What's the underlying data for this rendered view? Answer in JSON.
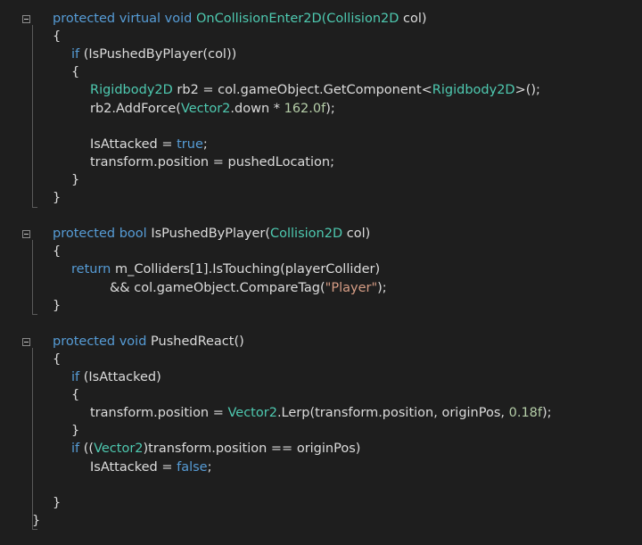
{
  "editor": {
    "background": "#1e1e1e",
    "colors": {
      "keyword": "#569cd6",
      "type": "#4ec9b0",
      "string": "#d69d85",
      "number": "#b5cea8",
      "text": "#dcdcdc"
    },
    "fold_icons": [
      "collapse-icon",
      "collapse-icon",
      "collapse-icon"
    ],
    "lines": [
      {
        "tokens": [
          {
            "t": "protected virtual void ",
            "c": "kw"
          },
          {
            "t": "OnCollisionEnter2D(",
            "c": "type"
          },
          {
            "t": "Collision2D",
            "c": "type"
          },
          {
            "t": " col)",
            "c": "plain"
          }
        ]
      },
      {
        "tokens": [
          {
            "t": "{",
            "c": "plain"
          }
        ]
      },
      {
        "tokens": [
          {
            "t": "if",
            "c": "kw"
          },
          {
            "t": " (IsPushedByPlayer(col))",
            "c": "plain"
          }
        ]
      },
      {
        "tokens": [
          {
            "t": "{",
            "c": "plain"
          }
        ]
      },
      {
        "tokens": [
          {
            "t": "Rigidbody2D",
            "c": "type"
          },
          {
            "t": " rb2 = col.gameObject.GetComponent<",
            "c": "plain"
          },
          {
            "t": "Rigidbody2D",
            "c": "type"
          },
          {
            "t": ">();",
            "c": "plain"
          }
        ]
      },
      {
        "tokens": [
          {
            "t": "rb2.AddForce(",
            "c": "plain"
          },
          {
            "t": "Vector2",
            "c": "type"
          },
          {
            "t": ".down * ",
            "c": "plain"
          },
          {
            "t": "162.0f",
            "c": "num"
          },
          {
            "t": ");",
            "c": "plain"
          }
        ]
      },
      {
        "tokens": []
      },
      {
        "tokens": [
          {
            "t": "IsAttacked = ",
            "c": "plain"
          },
          {
            "t": "true",
            "c": "kw"
          },
          {
            "t": ";",
            "c": "plain"
          }
        ]
      },
      {
        "tokens": [
          {
            "t": "transform.position = pushedLocation;",
            "c": "plain"
          }
        ]
      },
      {
        "tokens": [
          {
            "t": "}",
            "c": "plain"
          }
        ]
      },
      {
        "tokens": [
          {
            "t": "}",
            "c": "plain"
          }
        ]
      },
      {
        "tokens": []
      },
      {
        "tokens": [
          {
            "t": "protected bool ",
            "c": "kw"
          },
          {
            "t": "IsPushedByPlayer(",
            "c": "plain"
          },
          {
            "t": "Collision2D",
            "c": "type"
          },
          {
            "t": " col)",
            "c": "plain"
          }
        ]
      },
      {
        "tokens": [
          {
            "t": "{",
            "c": "plain"
          }
        ]
      },
      {
        "tokens": [
          {
            "t": "return",
            "c": "kw"
          },
          {
            "t": " m_Colliders[1].IsTouching(playerCollider)",
            "c": "plain"
          }
        ]
      },
      {
        "tokens": [
          {
            "t": "&& col.gameObject.CompareTag(",
            "c": "plain"
          },
          {
            "t": "\"Player\"",
            "c": "str"
          },
          {
            "t": ");",
            "c": "plain"
          }
        ]
      },
      {
        "tokens": [
          {
            "t": "}",
            "c": "plain"
          }
        ]
      },
      {
        "tokens": []
      },
      {
        "tokens": [
          {
            "t": "protected void ",
            "c": "kw"
          },
          {
            "t": "PushedReact()",
            "c": "plain"
          }
        ]
      },
      {
        "tokens": [
          {
            "t": "{",
            "c": "plain"
          }
        ]
      },
      {
        "tokens": [
          {
            "t": "if",
            "c": "kw"
          },
          {
            "t": " (IsAttacked)",
            "c": "plain"
          }
        ]
      },
      {
        "tokens": [
          {
            "t": "{",
            "c": "plain"
          }
        ]
      },
      {
        "tokens": [
          {
            "t": "transform.position = ",
            "c": "plain"
          },
          {
            "t": "Vector2",
            "c": "type"
          },
          {
            "t": ".Lerp(transform.position, originPos, ",
            "c": "plain"
          },
          {
            "t": "0.18f",
            "c": "num"
          },
          {
            "t": ");",
            "c": "plain"
          }
        ]
      },
      {
        "tokens": [
          {
            "t": "}",
            "c": "plain"
          }
        ]
      },
      {
        "tokens": [
          {
            "t": "if",
            "c": "kw"
          },
          {
            "t": " ((",
            "c": "plain"
          },
          {
            "t": "Vector2",
            "c": "type"
          },
          {
            "t": ")transform.position == originPos)",
            "c": "plain"
          }
        ]
      },
      {
        "tokens": [
          {
            "t": "IsAttacked = ",
            "c": "plain"
          },
          {
            "t": "false",
            "c": "kw"
          },
          {
            "t": ";",
            "c": "plain"
          }
        ]
      },
      {
        "tokens": []
      },
      {
        "tokens": [
          {
            "t": "}",
            "c": "plain"
          }
        ]
      },
      {
        "tokens": [
          {
            "t": "}",
            "c": "plain"
          }
        ]
      }
    ]
  }
}
